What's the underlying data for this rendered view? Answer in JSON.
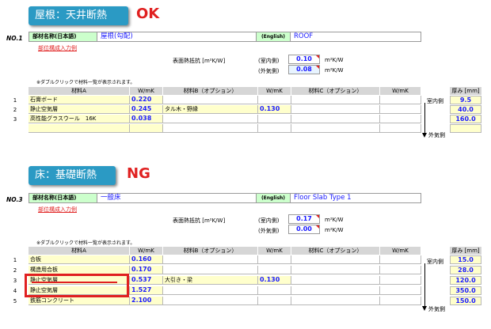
{
  "sections": [
    {
      "banner": "屋根：天井断熱",
      "badge": "OK",
      "no": "NO.1",
      "name_label": "部材名称(日本語)",
      "name_jp": "屋根(勾配)",
      "english_label": "(English)",
      "name_en": "ROOF",
      "link": "部位構成入力例",
      "resistance_label": "表面熱抵抗 [m²K/W]",
      "inner_label": "(室内側)",
      "inner_value": "0.10",
      "outer_label": "(外気側)",
      "outer_value": "0.08",
      "unit1": "m²K/W",
      "unit2": "m²K/W",
      "note": "※ダブルクリックで材料一覧が表示されます。",
      "headers": {
        "a": "材料A",
        "wa": "W/mK",
        "b": "材料B（オプション）",
        "wb": "W/mK",
        "c": "材料C（オプション）",
        "wc": "W/mK",
        "thk": "厚み [mm]"
      },
      "rows": [
        {
          "n": "1",
          "a": "石膏ボード",
          "wa": "0.220",
          "b": "",
          "wb": "",
          "thk": "9.5"
        },
        {
          "n": "2",
          "a": "静止空気層",
          "wa": "0.245",
          "b": "タル木・野縁",
          "wb": "0.130",
          "thk": "40.0"
        },
        {
          "n": "3",
          "a": "高性能グラスウール　16K",
          "wa": "0.038",
          "b": "",
          "wb": "",
          "thk": "160.0"
        },
        {
          "n": "",
          "a": "",
          "wa": "",
          "b": "",
          "wb": "",
          "thk": ""
        }
      ],
      "indoor": "室内側",
      "outdoor": "外気側"
    },
    {
      "banner": "床：基礎断熱",
      "badge": "NG",
      "no": "NO.3",
      "name_label": "部材名称(日本語)",
      "name_jp": "一般床",
      "english_label": "(English)",
      "name_en": "Floor Slab Type 1",
      "link": "部位構成入力例",
      "resistance_label": "表面熱抵抗 [m²K/W]",
      "inner_label": "(室内側)",
      "inner_value": "0.17",
      "outer_label": "(外気側)",
      "outer_value": "0.00",
      "unit1": "m²K/W",
      "unit2": "m²K/W",
      "note": "※ダブルクリックで材料一覧が表示されます。",
      "headers": {
        "a": "材料A",
        "wa": "W/mK",
        "b": "材料B（オプション）",
        "wb": "W/mK",
        "c": "材料C（オプション）",
        "wc": "W/mK",
        "thk": "厚み [mm]"
      },
      "rows": [
        {
          "n": "1",
          "a": "合板",
          "wa": "0.160",
          "b": "",
          "wb": "",
          "thk": "15.0"
        },
        {
          "n": "2",
          "a": "構造用合板",
          "wa": "0.170",
          "b": "",
          "wb": "",
          "thk": "28.0"
        },
        {
          "n": "3",
          "a": "静止空気層",
          "wa": "0.537",
          "b": "大引き・梁",
          "wb": "0.130",
          "thk": "120.0"
        },
        {
          "n": "4",
          "a": "静止空気層",
          "wa": "1.527",
          "b": "",
          "wb": "",
          "thk": "350.0"
        },
        {
          "n": "5",
          "a": "鉄筋コンクリート",
          "wa": "2.100",
          "b": "",
          "wb": "",
          "thk": "150.0"
        }
      ],
      "indoor": "室内側",
      "outdoor": "外気側"
    }
  ]
}
